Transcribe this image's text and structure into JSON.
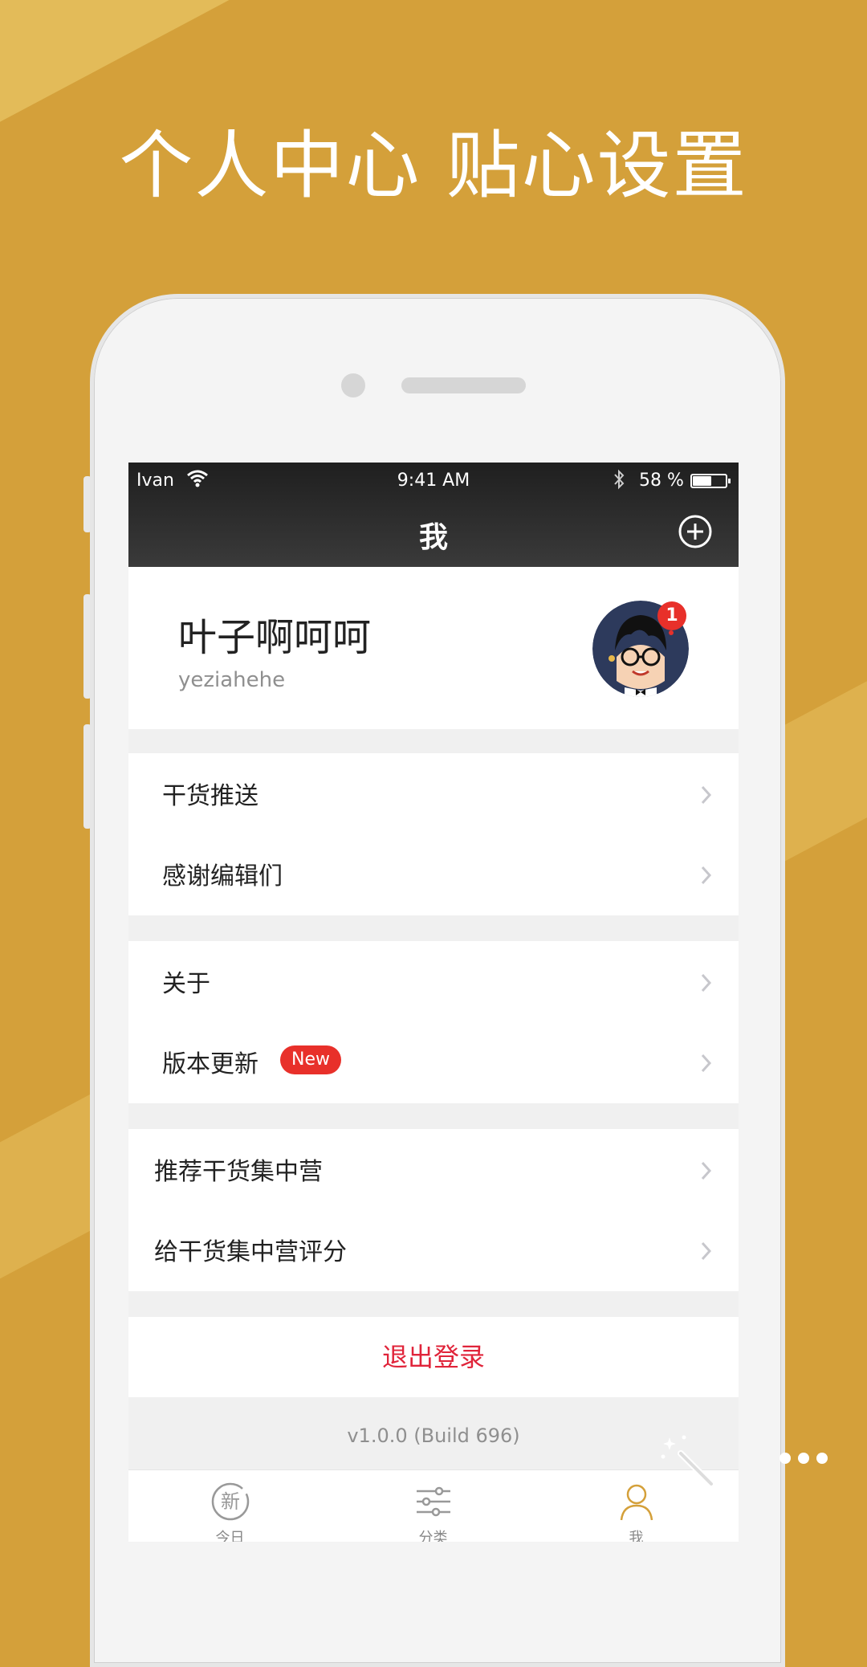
{
  "headline": "个人中心 贴心设置",
  "status_bar": {
    "carrier": "Ivan",
    "time": "9:41 AM",
    "battery": "58 %",
    "battery_level": 0.58
  },
  "nav": {
    "title": "我",
    "add_icon": "plus-circle-icon"
  },
  "profile": {
    "name": "叶子啊呵呵",
    "username": "yeziahehe",
    "badge": "1"
  },
  "menu_groups": [
    {
      "items": [
        {
          "label": "干货推送"
        },
        {
          "label": "感谢编辑们"
        }
      ]
    },
    {
      "items": [
        {
          "label": "关于"
        },
        {
          "label": "版本更新",
          "badge": "New"
        }
      ]
    },
    {
      "items": [
        {
          "label": "推荐干货集中营"
        },
        {
          "label": "给干货集中营评分"
        }
      ]
    }
  ],
  "logout_label": "退出登录",
  "version_text": "v1.0.0 (Build 696)",
  "tabs": [
    {
      "label": "今日",
      "icon": "new-badge-icon",
      "icon_text": "新"
    },
    {
      "label": "分类",
      "icon": "sliders-icon"
    },
    {
      "label": "我",
      "icon": "person-icon"
    }
  ],
  "colors": {
    "background": "#D4A03A",
    "accent_red": "#E8302A",
    "logout_red": "#E0243A",
    "active_tab": "#D4A03A"
  }
}
